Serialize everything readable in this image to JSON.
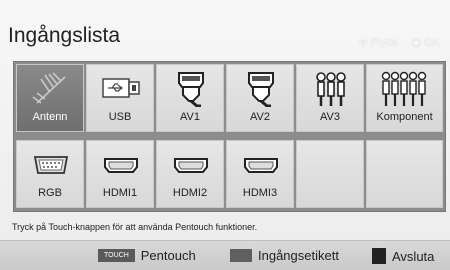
{
  "title": "Ingångslista",
  "hints": {
    "move": "Flytta",
    "ok": "OK"
  },
  "tiles": [
    {
      "label": "Antenn",
      "icon": "antenna-icon",
      "selected": true
    },
    {
      "label": "USB",
      "icon": "usb-icon",
      "selected": false
    },
    {
      "label": "AV1",
      "icon": "scart-icon",
      "selected": false
    },
    {
      "label": "AV2",
      "icon": "scart-icon",
      "selected": false
    },
    {
      "label": "AV3",
      "icon": "rca-av-icon",
      "selected": false
    },
    {
      "label": "Komponent",
      "icon": "component-icon",
      "selected": false
    },
    {
      "label": "RGB",
      "icon": "vga-icon",
      "selected": false
    },
    {
      "label": "HDMI1",
      "icon": "hdmi-icon",
      "selected": false
    },
    {
      "label": "HDMI2",
      "icon": "hdmi-icon",
      "selected": false
    },
    {
      "label": "HDMI3",
      "icon": "hdmi-icon",
      "selected": false
    },
    {
      "label": "",
      "icon": "",
      "selected": false
    },
    {
      "label": "",
      "icon": "",
      "selected": false
    }
  ],
  "help_text": "Tryck på Touch-knappen för att använda Pentouch funktioner.",
  "bottom_bar": {
    "touch_badge": "TOUCH",
    "pentouch": "Pentouch",
    "input_label": "Ingångsetikett",
    "exit": "Avsluta"
  }
}
